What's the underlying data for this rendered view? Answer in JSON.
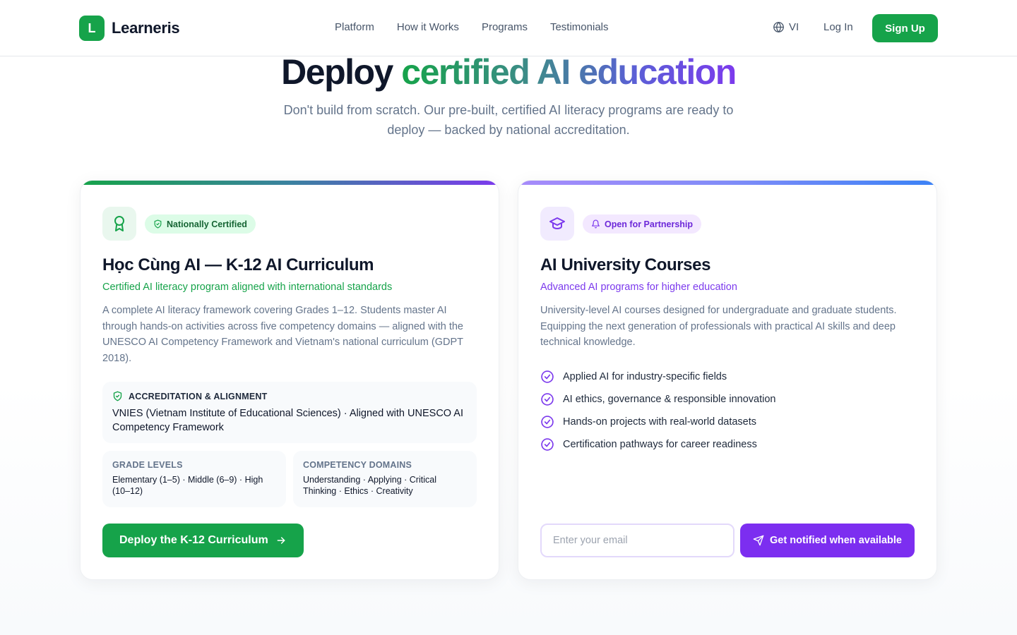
{
  "header": {
    "logo_letter": "L",
    "brand": "Learneris",
    "nav": [
      "Platform",
      "How it Works",
      "Programs",
      "Testimonials"
    ],
    "language": "VI",
    "login": "Log In",
    "signup": "Sign Up"
  },
  "hero": {
    "title_plain": "Deploy",
    "title_gradient": "certified AI education",
    "subtitle": "Don't build from scratch. Our pre-built, certified AI literacy programs are ready to deploy — backed by national accreditation."
  },
  "k12": {
    "icon": "award-icon",
    "badge": "Nationally Certified",
    "title": "Học Cùng AI — K-12 AI Curriculum",
    "tagline": "Certified AI literacy program aligned with international standards",
    "description": "A complete AI literacy framework covering Grades 1–12. Students master AI through hands-on activities across five competency domains — aligned with the UNESCO AI Competency Framework and Vietnam's national curriculum (GDPT 2018).",
    "accreditation_label": "ACCREDITATION & ALIGNMENT",
    "accreditation_text": "VNIES (Vietnam Institute of Educational Sciences) · Aligned with UNESCO AI Competency Framework",
    "grade_label": "GRADE LEVELS",
    "grade_text": "Elementary (1–5) · Middle (6–9) · High (10–12)",
    "domains_label": "COMPETENCY DOMAINS",
    "domains_text": "Understanding · Applying · Critical Thinking · Ethics · Creativity",
    "cta": "Deploy the K-12 Curriculum"
  },
  "university": {
    "icon": "graduation-cap-icon",
    "badge": "Open for Partnership",
    "title": "AI University Courses",
    "tagline": "Advanced AI programs for higher education",
    "description": "University-level AI courses designed for undergraduate and graduate students. Equipping the next generation of professionals with practical AI skills and deep technical knowledge.",
    "features": [
      "Applied AI for industry-specific fields",
      "AI ethics, governance & responsible innovation",
      "Hands-on projects with real-world datasets",
      "Certification pathways for career readiness"
    ],
    "email_placeholder": "Enter your email",
    "notify": "Get notified when available"
  },
  "colors": {
    "brand_green": "#16a34a",
    "brand_purple": "#7c3aed"
  }
}
